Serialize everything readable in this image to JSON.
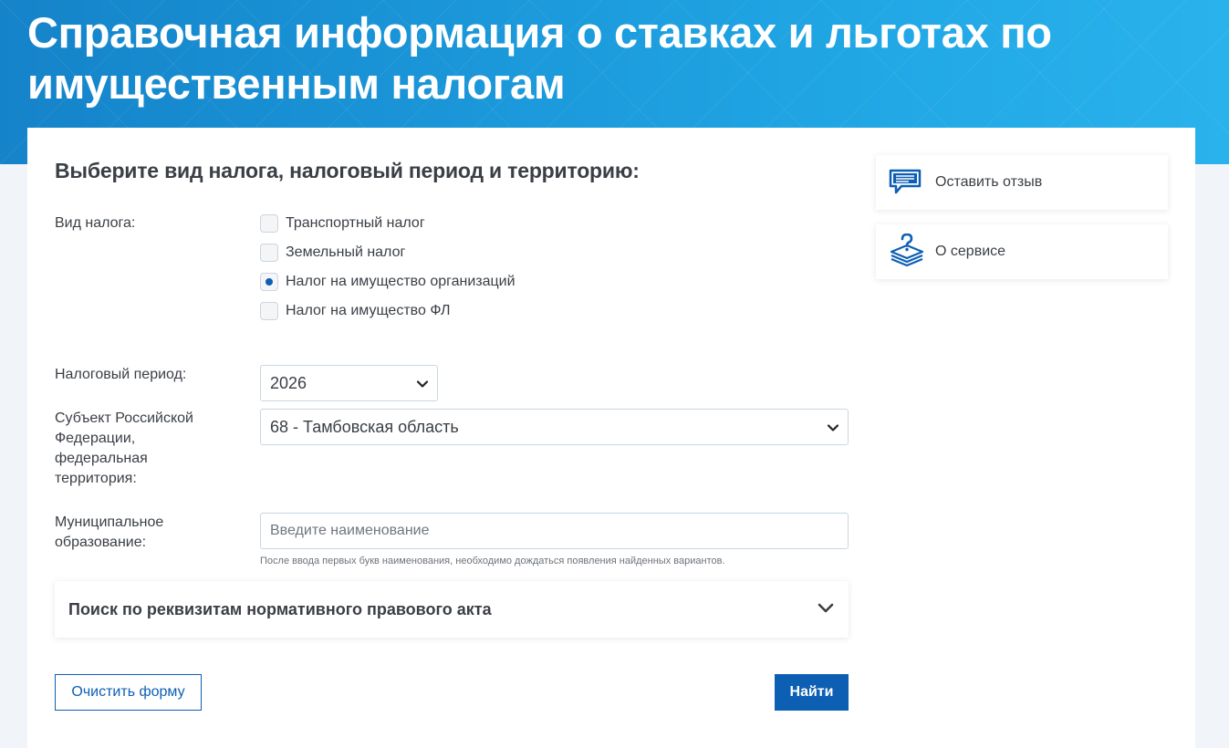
{
  "page": {
    "title": "Справочная информация о ставках и льготах по имущественным налогам"
  },
  "form": {
    "heading": "Выберите вид налога, налоговый период и территорию:",
    "tax_type": {
      "label": "Вид налога:",
      "options": [
        {
          "label": "Транспортный налог",
          "checked": false
        },
        {
          "label": "Земельный налог",
          "checked": false
        },
        {
          "label": "Налог на имущество организаций",
          "checked": true
        },
        {
          "label": "Налог на имущество ФЛ",
          "checked": false
        }
      ]
    },
    "tax_period": {
      "label": "Налоговый период:",
      "value": "2026"
    },
    "region": {
      "label": "Субъект Российской Федерации, федеральная территория:",
      "value": "68 - Тамбовская область"
    },
    "municipality": {
      "label": "Муниципальное образование:",
      "value": "",
      "placeholder": "Введите наименование",
      "hint": "После ввода первых букв наименования, необходимо дождаться появления найденных вариантов."
    },
    "accordion": {
      "title": "Поиск по реквизитам нормативного правового акта"
    },
    "buttons": {
      "clear": "Очистить форму",
      "find": "Найти"
    }
  },
  "sidebar": {
    "feedback": "Оставить отзыв",
    "about": "О сервисе"
  },
  "colors": {
    "brand_blue": "#0d5fb4",
    "banner": "#1b98da"
  }
}
